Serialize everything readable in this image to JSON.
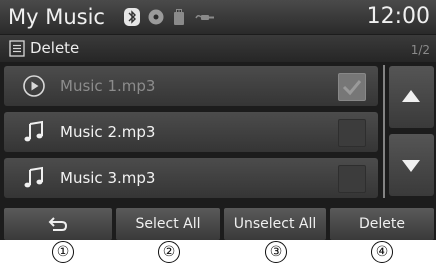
{
  "status_bar": {
    "title": "My Music",
    "time": "12:00",
    "icons": [
      "bluetooth-icon",
      "disc-icon",
      "usb-icon",
      "aux-icon"
    ]
  },
  "header": {
    "mode_icon": "list-icon",
    "mode_label": "Delete",
    "page": "1/2"
  },
  "list": {
    "items": [
      {
        "icon": "play-circle-icon",
        "label": "Music 1.mp3",
        "checked": true,
        "disabled": true
      },
      {
        "icon": "music-note-icon",
        "label": "Music 2.mp3",
        "checked": false,
        "disabled": false
      },
      {
        "icon": "music-note-icon",
        "label": "Music 3.mp3",
        "checked": false,
        "disabled": false
      }
    ]
  },
  "scroll": {
    "up_icon": "triangle-up-icon",
    "down_icon": "triangle-down-icon"
  },
  "buttons": {
    "back_icon": "back-arrow-icon",
    "select_all": "Select All",
    "unselect_all": "Unselect All",
    "delete": "Delete"
  },
  "callouts": [
    "①",
    "②",
    "③",
    "④"
  ],
  "colors": {
    "background": "#1c1c1c",
    "text": "#f0f0f0",
    "disabled_text": "#8c8c8c"
  }
}
